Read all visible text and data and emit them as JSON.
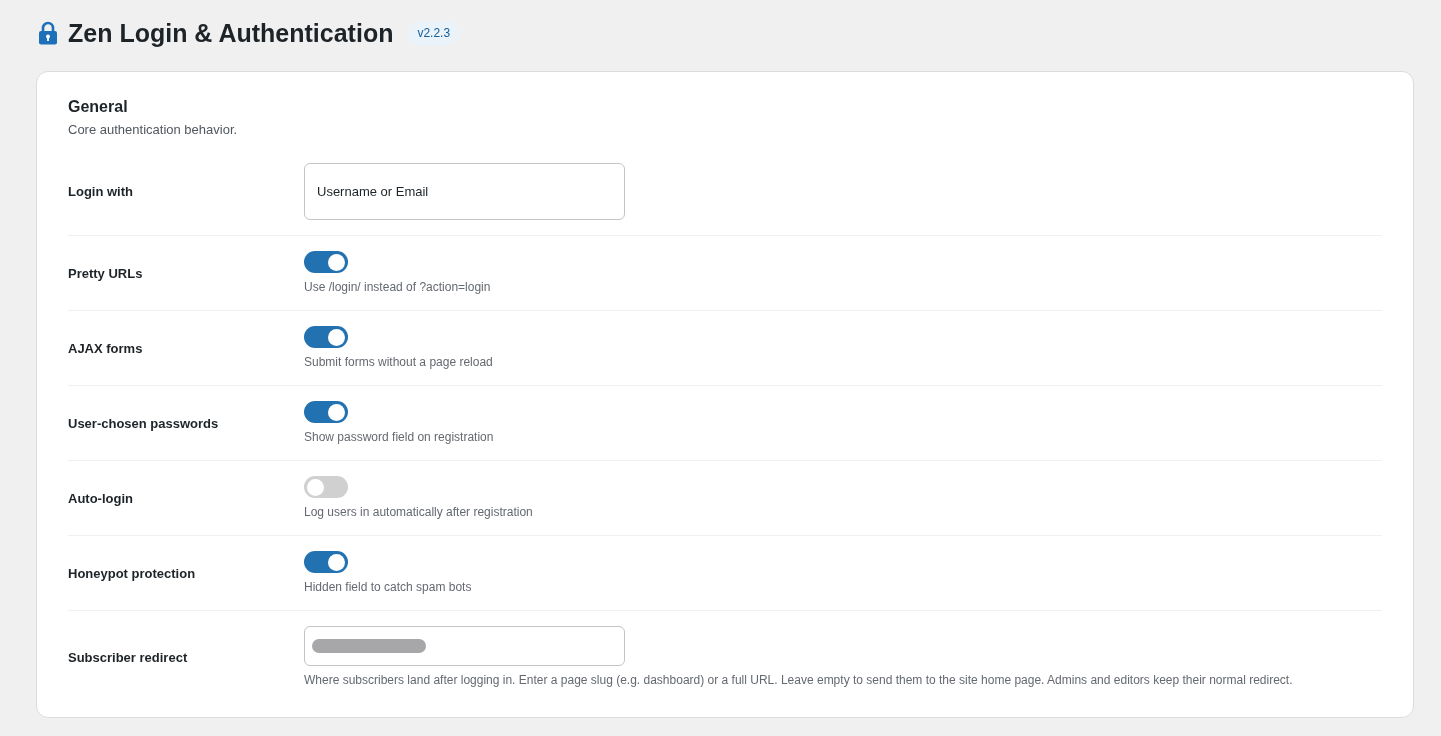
{
  "header": {
    "title": "Zen Login & Authentication",
    "version": "v2.2.3"
  },
  "section": {
    "title": "General",
    "description": "Core authentication behavior."
  },
  "settings": [
    {
      "kind": "select",
      "label": "Login with",
      "value": "Username or Email"
    },
    {
      "kind": "toggle",
      "label": "Pretty URLs",
      "on": true,
      "description": "Use /login/ instead of ?action=login"
    },
    {
      "kind": "toggle",
      "label": "AJAX forms",
      "on": true,
      "description": "Submit forms without a page reload"
    },
    {
      "kind": "toggle",
      "label": "User-chosen passwords",
      "on": true,
      "description": "Show password field on registration"
    },
    {
      "kind": "toggle",
      "label": "Auto-login",
      "on": false,
      "description": "Log users in automatically after registration"
    },
    {
      "kind": "toggle",
      "label": "Honeypot protection",
      "on": true,
      "description": "Hidden field to catch spam bots"
    },
    {
      "kind": "text",
      "label": "Subscriber redirect",
      "redacted": true,
      "description": "Where subscribers land after logging in. Enter a page slug (e.g. dashboard) or a full URL. Leave empty to send them to the site home page. Admins and editors keep their normal redirect."
    }
  ]
}
